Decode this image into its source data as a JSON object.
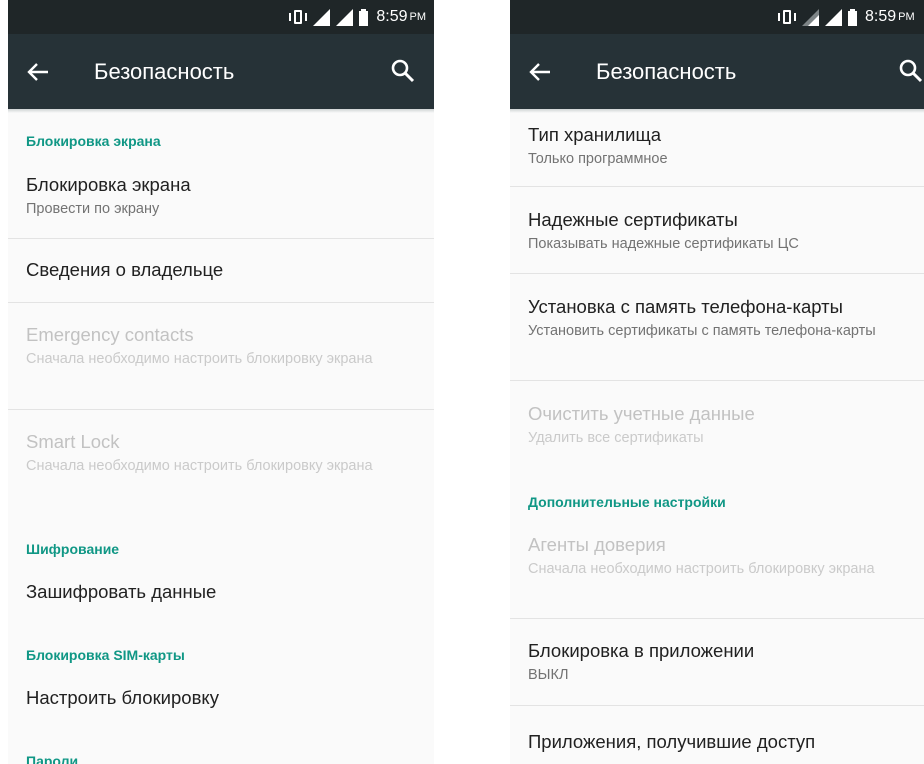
{
  "status_bar": {
    "time": "8:59",
    "ampm": "PM"
  },
  "app_bar": {
    "title": "Безопасность"
  },
  "colors": {
    "app_bar": "#263237",
    "status_bar": "#1f2628",
    "accent": "#109785",
    "background": "#fafafa"
  },
  "icons": {
    "back": "back-arrow-icon",
    "search": "search-icon",
    "vibrate": "vibrate-icon",
    "signal": "signal-icon",
    "battery": "battery-icon"
  },
  "left_screen": {
    "categories": {
      "screen_lock": "Блокировка экрана",
      "encryption": "Шифрование",
      "sim_lock": "Блокировка SIM-карты",
      "passwords": "Пароли"
    },
    "items": {
      "screen_lock": {
        "title": "Блокировка экрана",
        "summary": "Провести по экрану"
      },
      "owner_info": {
        "title": "Сведения о владельце"
      },
      "emergency_contacts": {
        "title": "Emergency contacts",
        "summary": "Сначала необходимо настроить блокировку экрана"
      },
      "smart_lock": {
        "title": "Smart Lock",
        "summary": "Сначала необходимо настроить блокировку экрана"
      },
      "encrypt_data": {
        "title": "Зашифровать данные"
      },
      "setup_sim_lock": {
        "title": "Настроить блокировку"
      }
    }
  },
  "right_screen": {
    "categories": {
      "advanced": "Дополнительные настройки"
    },
    "items": {
      "storage_type": {
        "title": "Тип хранилища",
        "summary": "Только программное"
      },
      "trusted_certs": {
        "title": "Надежные сертификаты",
        "summary": "Показывать надежные сертификаты ЦС"
      },
      "install_from_sd": {
        "title": "Установка с память телефона-карты",
        "summary": "Установить сертификаты с память телефона-карты"
      },
      "clear_credentials": {
        "title": "Очистить учетные данные",
        "summary": "Удалить все сертификаты"
      },
      "trust_agents": {
        "title": "Агенты доверия",
        "summary": "Сначала необходимо настроить блокировку экрана"
      },
      "app_pinning": {
        "title": "Блокировка в приложении",
        "summary": "ВЫКЛ"
      },
      "usage_access": {
        "title": "Приложения, получившие доступ"
      }
    }
  }
}
